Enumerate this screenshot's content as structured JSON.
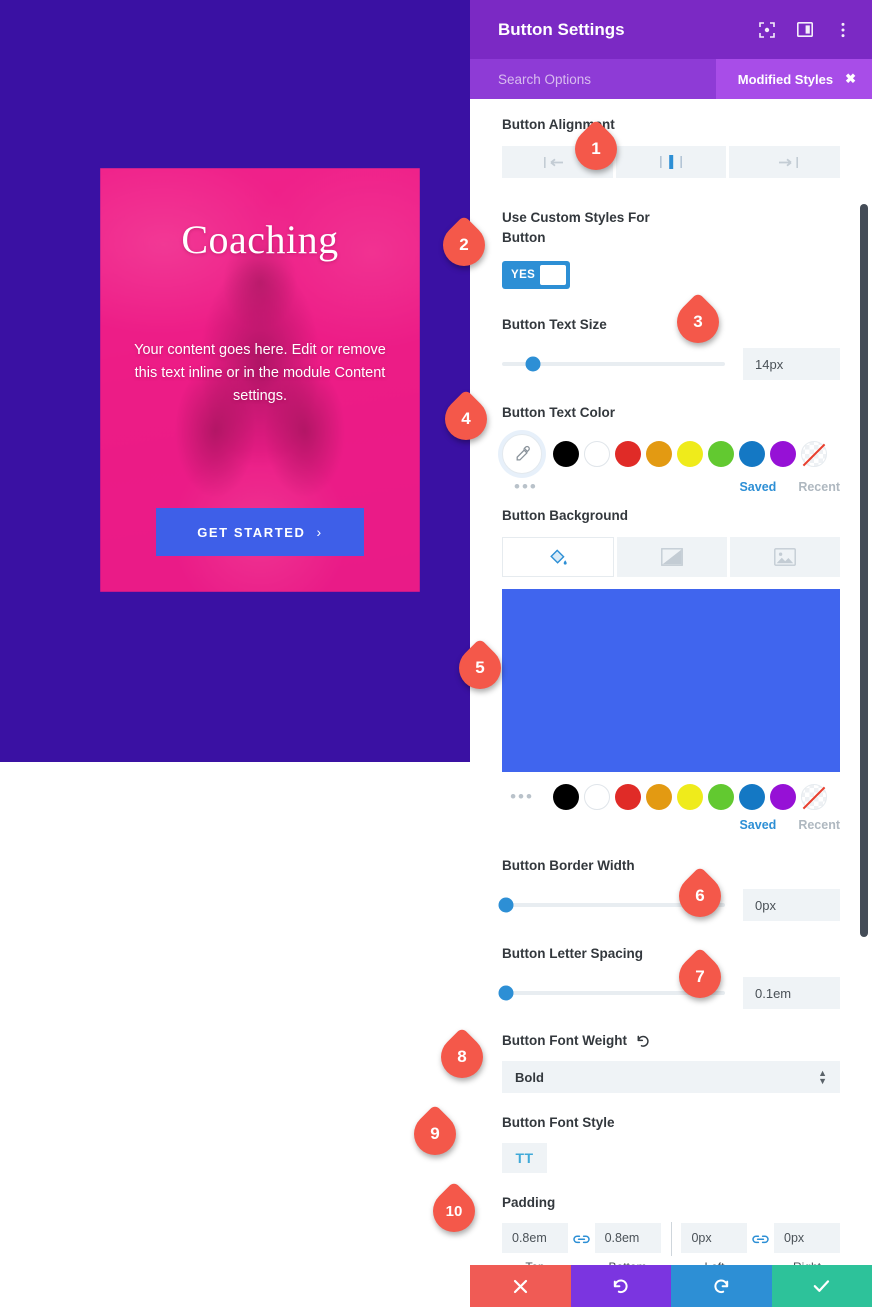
{
  "preview": {
    "title": "Coaching",
    "body": "Your content goes here. Edit or remove this text inline or in the module Content settings.",
    "button_label": "GET STARTED",
    "button_chevron": "›",
    "bg_color": "#3A11A3",
    "card_overlay": "#ED1C86",
    "button_color": "#3E5FE8"
  },
  "panel": {
    "title": "Button Settings",
    "header_icons": [
      "expand-icon",
      "layout-panel-icon",
      "more-vertical-icon"
    ],
    "search_placeholder": "Search Options",
    "modified_badge": "Modified Styles",
    "modified_badge_close": "✖",
    "accent_color": "#7B29C4"
  },
  "fields": {
    "alignment": {
      "label": "Button Alignment",
      "options": [
        "align-left-icon",
        "align-center-icon",
        "align-right-icon"
      ],
      "selected": "align-center-icon"
    },
    "custom_styles": {
      "label": "Use Custom Styles For Button",
      "value": "YES",
      "on": true
    },
    "text_size": {
      "label": "Button Text Size",
      "value": "14px",
      "slider_percent": 14
    },
    "text_color": {
      "label": "Button Text Color",
      "eyedropper": "eyedropper-icon",
      "more": "•••",
      "swatches": [
        "#000000",
        "#FFFFFF",
        "#E02B27",
        "#E39A12",
        "#EFEB1B",
        "#62C930",
        "#1478C4",
        "#9611D6",
        "none"
      ],
      "saved_label": "Saved",
      "recent_label": "Recent"
    },
    "background": {
      "label": "Button Background",
      "tabs": [
        "fill-color-icon",
        "gradient-icon",
        "image-icon"
      ],
      "selected_tab": "fill-color-icon",
      "color": "#4065EE",
      "more": "•••",
      "swatches": [
        "#000000",
        "#FFFFFF",
        "#E02B27",
        "#E39A12",
        "#EFEB1B",
        "#62C930",
        "#1478C4",
        "#9611D6",
        "none"
      ],
      "saved_label": "Saved",
      "recent_label": "Recent"
    },
    "border_width": {
      "label": "Button Border Width",
      "value": "0px",
      "slider_percent": 0
    },
    "letter_spacing": {
      "label": "Button Letter Spacing",
      "value": "0.1em",
      "slider_percent": 0
    },
    "font_weight": {
      "label": "Button Font Weight",
      "reset_icon": "reset-icon",
      "value": "Bold"
    },
    "font_style": {
      "label": "Button Font Style",
      "value": "TT"
    },
    "padding": {
      "label": "Padding",
      "fields": [
        {
          "value": "0.8em",
          "name": "Top"
        },
        {
          "value": "0.8em",
          "name": "Bottom"
        },
        {
          "value": "0px",
          "name": "Left"
        },
        {
          "value": "0px",
          "name": "Right"
        }
      ],
      "link_icon": "link-chain-icon"
    }
  },
  "markers": [
    {
      "n": "1"
    },
    {
      "n": "2"
    },
    {
      "n": "3"
    },
    {
      "n": "4"
    },
    {
      "n": "5"
    },
    {
      "n": "6"
    },
    {
      "n": "7"
    },
    {
      "n": "8"
    },
    {
      "n": "9"
    },
    {
      "n": "10"
    }
  ],
  "bottom_bar": {
    "cancel": "close-icon",
    "undo": "undo-icon",
    "redo": "redo-icon",
    "save": "check-icon"
  }
}
